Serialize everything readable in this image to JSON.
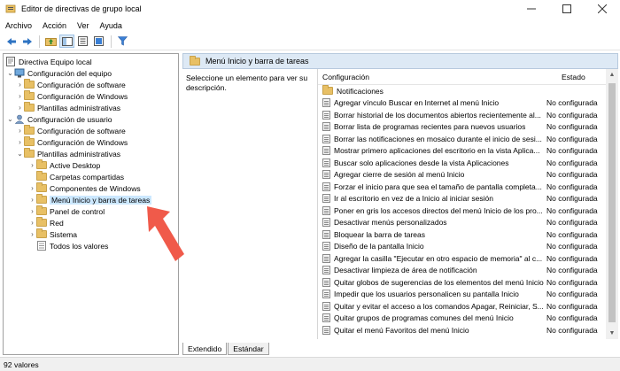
{
  "window": {
    "title": "Editor de directivas de grupo local"
  },
  "menu": [
    "Archivo",
    "Acción",
    "Ver",
    "Ayuda"
  ],
  "tree": {
    "root": "Directiva Equipo local",
    "computer_config": "Configuración del equipo",
    "computer_children": [
      "Configuración de software",
      "Configuración de Windows",
      "Plantillas administrativas"
    ],
    "user_config": "Configuración de usuario",
    "user_children": [
      "Configuración de software",
      "Configuración de Windows",
      "Plantillas administrativas"
    ],
    "admin_templates_children": [
      "Active Desktop",
      "Carpetas compartidas",
      "Componentes de Windows",
      "Menú Inicio y barra de tareas",
      "Panel de control",
      "Red",
      "Sistema",
      "Todos los valores"
    ]
  },
  "right_panel": {
    "header": "Menú Inicio y barra de tareas",
    "description": "Seleccione un elemento para ver su descripción.",
    "columns": {
      "config": "Configuración",
      "state": "Estado"
    },
    "folder_row": "Notificaciones",
    "rows": [
      {
        "name": "Agregar vínculo Buscar en Internet al menú Inicio",
        "state": "No configurada"
      },
      {
        "name": "Borrar historial de los documentos abiertos recientemente al...",
        "state": "No configurada"
      },
      {
        "name": "Borrar lista de programas recientes para nuevos usuarios",
        "state": "No configurada"
      },
      {
        "name": "Borrar las notificaciones en mosaico durante el inicio de sesi...",
        "state": "No configurada"
      },
      {
        "name": "Mostrar primero aplicaciones del escritorio en la vista Aplica...",
        "state": "No configurada"
      },
      {
        "name": "Buscar solo aplicaciones desde la vista Aplicaciones",
        "state": "No configurada"
      },
      {
        "name": "Agregar cierre de sesión al menú Inicio",
        "state": "No configurada"
      },
      {
        "name": "Forzar el inicio para que sea el tamaño de pantalla completa...",
        "state": "No configurada"
      },
      {
        "name": "Ir al escritorio en vez de a Inicio al iniciar sesión",
        "state": "No configurada"
      },
      {
        "name": "Poner en gris los accesos directos del menú Inicio de los pro...",
        "state": "No configurada"
      },
      {
        "name": "Desactivar menús personalizados",
        "state": "No configurada"
      },
      {
        "name": "Bloquear la barra de tareas",
        "state": "No configurada"
      },
      {
        "name": "Diseño de la pantalla Inicio",
        "state": "No configurada"
      },
      {
        "name": "Agregar la casilla \"Ejecutar en otro espacio de memoria\" al c...",
        "state": "No configurada"
      },
      {
        "name": "Desactivar limpieza de área de notificación",
        "state": "No configurada"
      },
      {
        "name": "Quitar globos de sugerencias de los elementos del menú Inicio",
        "state": "No configurada"
      },
      {
        "name": "Impedir que los usuarios personalicen su pantalla Inicio",
        "state": "No configurada"
      },
      {
        "name": "Quitar y evitar el acceso a los comandos Apagar, Reiniciar, S...",
        "state": "No configurada"
      },
      {
        "name": "Quitar grupos de programas comunes del menú Inicio",
        "state": "No configurada"
      },
      {
        "name": "Quitar el menú Favoritos del menú Inicio",
        "state": "No configurada"
      }
    ]
  },
  "tabs": [
    "Extendido",
    "Estándar"
  ],
  "status": "92 valores",
  "colors": {
    "selection": "#cce8ff",
    "header": "#dde9f5",
    "folder": "#e8c065",
    "arrow": "#f05a4a"
  }
}
